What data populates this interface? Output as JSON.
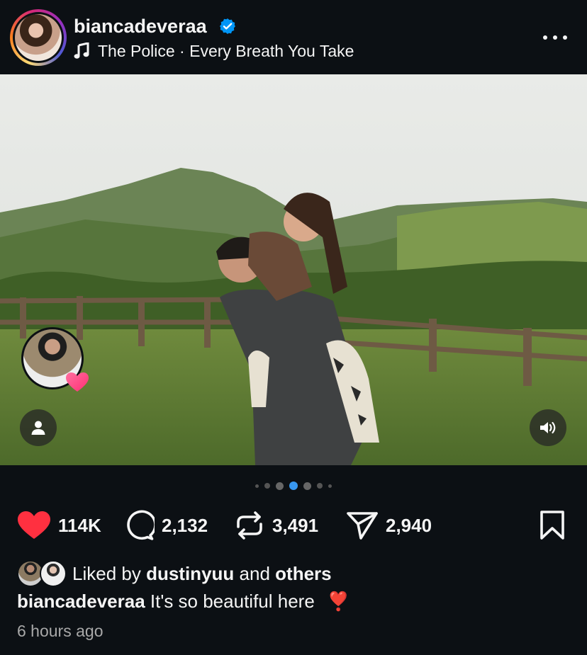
{
  "post": {
    "username": "biancadeveraa",
    "verified_icon": "verified-badge-icon",
    "music_icon": "music-note-icon",
    "song": "The Police · Every Breath You Take",
    "more_icon": "more-options-icon",
    "carousel": {
      "total": 7,
      "current": 4
    },
    "tag_icon": "user-tag-icon",
    "sound_icon": "speaker-icon",
    "actions": {
      "likes": "114K",
      "comments": "2,132",
      "reposts": "3,491",
      "shares": "2,940"
    },
    "liked_by": {
      "prefix": "Liked by",
      "user": "dustinyuu",
      "and": "and",
      "others": "others"
    },
    "caption": {
      "user": "biancadeveraa",
      "text": "It's so beautiful here",
      "emoji": "❣️"
    },
    "time": "6 hours ago",
    "colors": {
      "background": "#0c1014",
      "like": "#ff3040",
      "active_dot": "#3897f0",
      "verified": "#0095f6"
    }
  }
}
